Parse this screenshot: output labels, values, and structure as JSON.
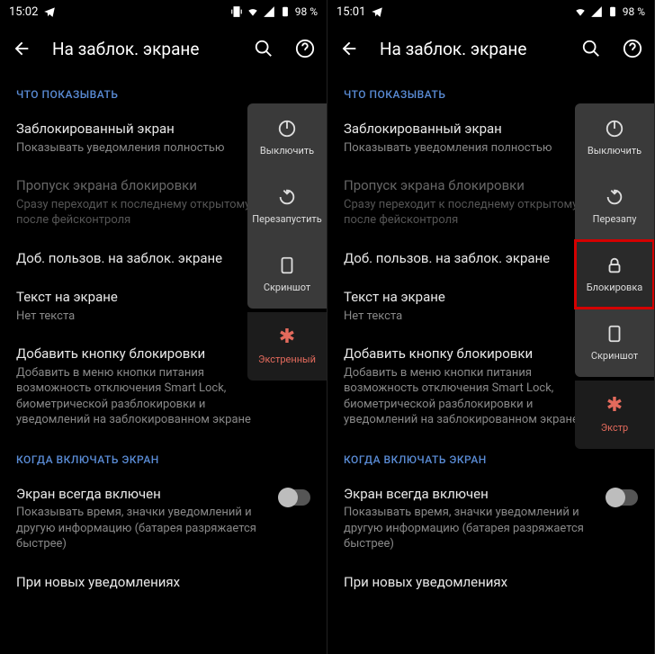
{
  "left": {
    "status": {
      "time": "15:02",
      "battery_text": "98 %"
    },
    "appbar": {
      "title": "На заблок. экране"
    },
    "sections": {
      "show": {
        "header": "ЧТО ПОКАЗЫВАТЬ",
        "lock_screen": {
          "title": "Заблокированный экран",
          "sub": "Показывать уведомления полностью"
        },
        "skip": {
          "title": "Пропуск экрана блокировки",
          "sub": "Сразу переходит к последнему открытому экрану после фейсконтроля"
        },
        "add_users": {
          "title": "Доб. пользов. на заблок. экране"
        },
        "text_on_screen": {
          "title": "Текст на экране",
          "sub": "Нет текста"
        },
        "add_lock_btn": {
          "title": "Добавить кнопку блокировки",
          "sub": "Добавить в меню кнопки питания возможность отключения Smart Lock, биометрической разблокировки и уведомлений на заблокированном экране"
        }
      },
      "when": {
        "header": "КОГДА ВКЛЮЧАТЬ ЭКРАН",
        "always_on": {
          "title": "Экран всегда включен",
          "sub": "Показывать время, значки уведомлений и другую информацию (батарея разряжается быстрее)"
        },
        "new_notif": {
          "title": "При новых уведомлениях"
        }
      }
    },
    "power": {
      "off": "Выключить",
      "restart": "Перезапустить",
      "screenshot": "Скриншот",
      "emergency": "Экстренный"
    }
  },
  "right": {
    "status": {
      "time": "15:01",
      "battery_text": "98 %"
    },
    "appbar": {
      "title": "На заблок. экране"
    },
    "sections": {
      "show": {
        "header": "ЧТО ПОКАЗЫВАТЬ",
        "lock_screen": {
          "title": "Заблокированный экран",
          "sub": "Показывать уведомления полностью"
        },
        "skip": {
          "title": "Пропуск экрана блокировки",
          "sub": "Сразу переходит к последнему открытому экрану после фейсконтроля"
        },
        "add_users": {
          "title": "Доб. пользов. на заблок. экране"
        },
        "text_on_screen": {
          "title": "Текст на экране",
          "sub": "Нет текста"
        },
        "add_lock_btn": {
          "title": "Добавить кнопку блокировки",
          "sub": "Добавить в меню кнопки питания возможность отключения Smart Lock, биометрической разблокировки и уведомлений на заблокированном экране"
        }
      },
      "when": {
        "header": "КОГДА ВКЛЮЧАТЬ ЭКРАН",
        "always_on": {
          "title": "Экран всегда включен",
          "sub": "Показывать время, значки уведомлений и другую информацию (батарея разряжается быстрее)"
        },
        "new_notif": {
          "title": "При новых уведомлениях"
        }
      }
    },
    "power": {
      "off": "Выключить",
      "restart": "Перезапу",
      "lock": "Блокировка",
      "screenshot": "Скриншот",
      "emergency": "Экстр"
    }
  }
}
